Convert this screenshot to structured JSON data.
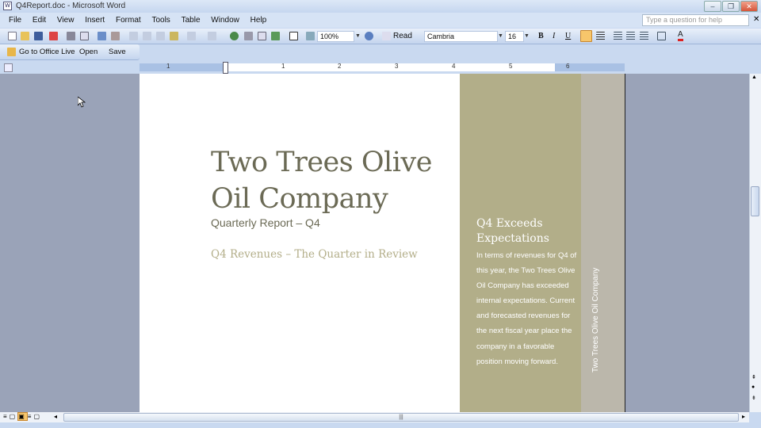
{
  "window": {
    "title": "Q4Report.doc - Microsoft Word"
  },
  "menu": [
    "File",
    "Edit",
    "View",
    "Insert",
    "Format",
    "Tools",
    "Table",
    "Window",
    "Help"
  ],
  "help_box": {
    "placeholder": "Type a question for help"
  },
  "toolbar": {
    "zoom": "100%",
    "read_label": "Read",
    "font": "Cambria",
    "font_size": "16",
    "bold": "B",
    "italic": "I",
    "underline": "U",
    "font_color_letter": "A"
  },
  "office_live": {
    "go_label": "Go to Office Live",
    "open_label": "Open",
    "save_label": "Save"
  },
  "ruler": {
    "numbers": [
      "1",
      "1",
      "2",
      "3",
      "4",
      "5",
      "6"
    ]
  },
  "document": {
    "title": "Two Trees Olive Oil Company",
    "subtitle": "Quarterly Report – Q4",
    "heading": "Q4 Revenues – The Quarter in Review",
    "sidebar_heading": "Q4 Exceeds Expectations",
    "sidebar_body": "In terms of revenues for Q4 of this year, the Two Trees Olive Oil Company has exceeded internal expectations.  Current and forecasted revenues for the next fiscal year place the company in a favorable position moving forward.",
    "vertical_text": "Two Trees Olive Oil Company"
  },
  "colors": {
    "sidebar_green": "#b2ae89",
    "sidebar_gray": "#bbb7ab",
    "title": "#6b6a55",
    "doc_bg": "#9aa3b8"
  }
}
